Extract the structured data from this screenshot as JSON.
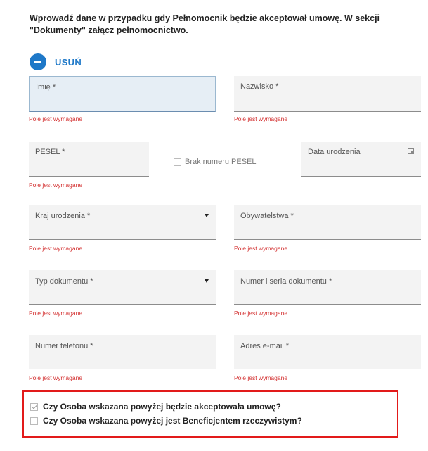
{
  "intro": "Wprowadź dane w przypadku gdy Pełnomocnik będzie akceptował umowę. W sekcji \"Dokumenty\" załącz pełnomocnictwo.",
  "remove_label": "USUŃ",
  "fields": {
    "imie": "Imię *",
    "nazwisko": "Nazwisko *",
    "pesel": "PESEL *",
    "brak_pesel": "Brak numeru PESEL",
    "data_urodzenia": "Data urodzenia",
    "kraj_urodzenia": "Kraj urodzenia *",
    "obywatelstwa": "Obywatelstwa *",
    "typ_dokumentu": "Typ dokumentu *",
    "numer_dokumentu": "Numer i seria dokumentu *",
    "telefon": "Numer telefonu *",
    "email": "Adres e-mail *"
  },
  "error_text": "Pole jest wymagane",
  "options": {
    "akceptowala": "Czy Osoba wskazana powyżej będzie akceptowała umowę?",
    "beneficjent": "Czy Osoba wskazana powyżej jest Beneficjentem rzeczywistym?"
  },
  "option_states": {
    "akceptowala": true,
    "beneficjent": false
  },
  "colors": {
    "accent": "#1e78c8",
    "error": "#d32f2f",
    "highlight": "#e21a1a"
  }
}
